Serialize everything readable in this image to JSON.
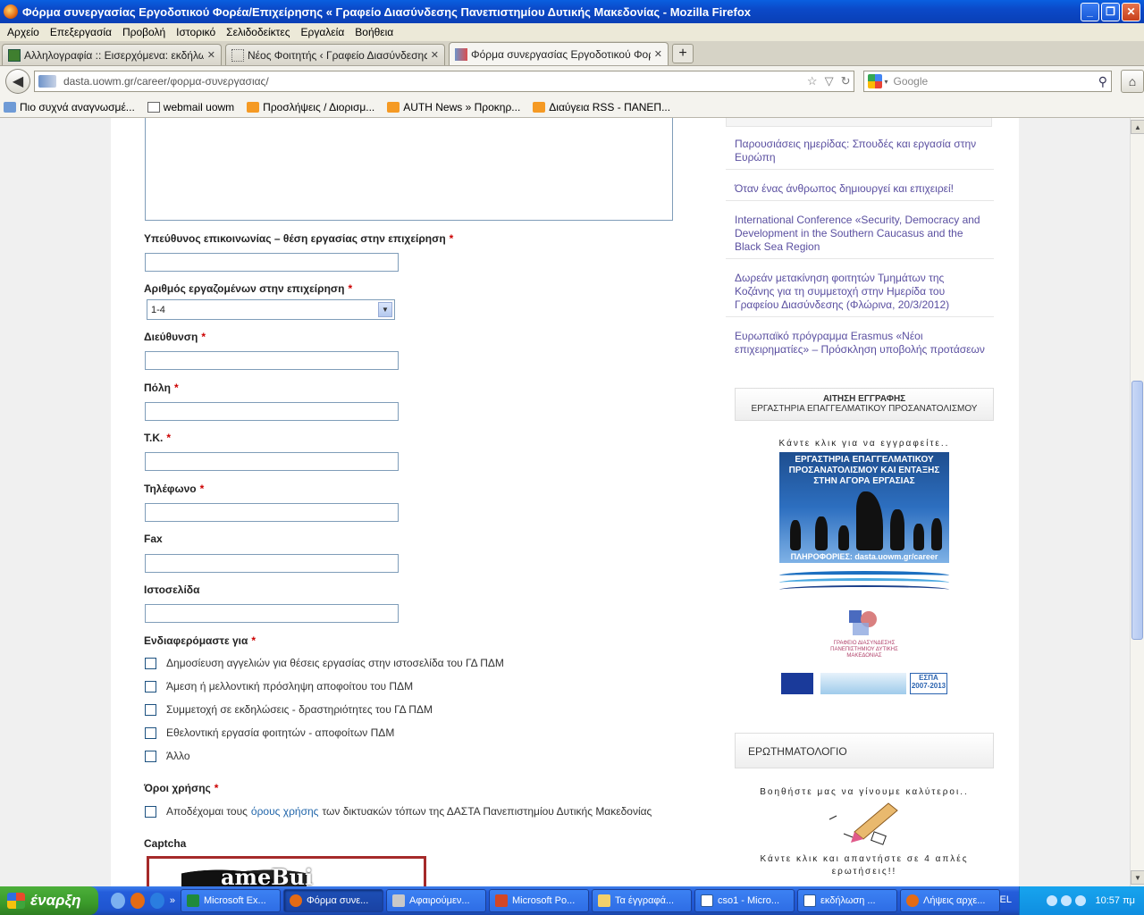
{
  "window": {
    "title": "Φόρμα συνεργασίας Εργοδοτικού Φορέα/Επιχείρησης « Γραφείο Διασύνδεσης Πανεπιστημίου Δυτικής Μακεδονίας - Mozilla Firefox",
    "min": "_",
    "max": "❐",
    "close": "✕"
  },
  "menu": [
    "Αρχείο",
    "Επεξεργασία",
    "Προβολή",
    "Ιστορικό",
    "Σελιδοδείκτες",
    "Εργαλεία",
    "Βοήθεια"
  ],
  "tabs": [
    {
      "label": "Αλληλογραφία :: Εισερχόμενα: εκδήλωσ...",
      "close": "✕"
    },
    {
      "label": "Νέος Φοιτητής ‹ Γραφείο Διασύνδεσης Πα...",
      "close": "✕"
    },
    {
      "label": "Φόρμα συνεργασίας Εργοδοτικού Φορέα/...",
      "close": "✕"
    }
  ],
  "newtab": "+",
  "nav": {
    "back": "◀",
    "url": "dasta.uowm.gr/career/φορμα-συνεργασιας/",
    "star": "☆",
    "dropdown": "▽",
    "reload": "↻",
    "search_placeholder": "Google",
    "search_arrow": "▾",
    "search_icon": "⚲",
    "home": "⌂"
  },
  "bookmarks": [
    {
      "label": "Πιο συχνά αναγνωσμέ...",
      "icon": "bookmark-folder-icon"
    },
    {
      "label": "webmail uowm",
      "icon": "mail-icon"
    },
    {
      "label": "Προσλήψεις / Διορισμ...",
      "icon": "rss-icon"
    },
    {
      "label": "AUTH News » Προκηρ...",
      "icon": "rss-icon"
    },
    {
      "label": "Διαύγεια RSS - ΠΑΝΕΠ...",
      "icon": "rss-icon"
    }
  ],
  "form": {
    "fields": {
      "contact_position": "Υπεύθυνος επικοινωνίας – θέση εργασίας στην επιχείρηση",
      "employees": "Αριθμός εργαζομένων στην επιχείρηση",
      "address": "Διεύθυνση",
      "city": "Πόλη",
      "zip": "Τ.Κ.",
      "phone": "Τηλέφωνο",
      "fax": "Fax",
      "website": "Ιστοσελίδα",
      "interest": "Ενδιαφερόμαστε για",
      "terms": "Όροι χρήσης",
      "captcha": "Captcha"
    },
    "required_mark": "*",
    "employees_value": "1-4",
    "dropdown_arrow": "▼",
    "interest_options": [
      "Δημοσίευση αγγελιών για θέσεις εργασίας στην ιστοσελίδα του ΓΔ ΠΔΜ",
      "Άμεση ή μελλοντική πρόσληψη αποφοίτου του ΠΔΜ",
      "Συμμετοχή σε εκδηλώσεις - δραστηριότητες του ΓΔ ΠΔΜ",
      "Εθελοντική εργασία φοιτητών - αποφοίτων ΠΔΜ",
      "Άλλο"
    ],
    "terms_text_before": "Αποδέχομαι τους",
    "terms_link": "όρους χρήσης",
    "terms_text_after": "των δικτυακών τόπων της ΔΑΣΤΑ Πανεπιστημίου Δυτικής Μακεδονίας",
    "captcha_text": "ameBui"
  },
  "sidebar": {
    "news": [
      "Παρουσιάσεις ημερίδας: Σπουδές και εργασία στην Ευρώπη",
      "Όταν ένας άνθρωπος δημιουργεί και επιχειρεί!",
      "International Conference «Security, Democracy and Development in the Southern Caucasus and the Black Sea Region",
      "Δωρεάν μετακίνηση φοιτητών Τμημάτων της Κοζάνης για τη συμμετοχή στην Ημερίδα του Γραφείου Διασύνδεσης (Φλώρινα, 20/3/2012)",
      "Ευρωπαϊκό πρόγραμμα Erasmus «Νέοι επιχειρηματίες» – Πρόσκληση υποβολής προτάσεων"
    ],
    "registration": {
      "title": "ΑΙΤΗΣΗ ΕΓΓΡΑΦΗΣ",
      "subtitle": "ΕΡΓΑΣΤΗΡΙΑ ΕΠΑΓΓΕΛΜΑΤΙΚΟΥ ΠΡΟΣΑΝΑΤΟΛΙΣΜΟΥ",
      "click_text": "Κάντε κλικ για να εγγραφείτε..",
      "banner_title": "ΕΡΓΑΣΤΗΡΙΑ ΕΠΑΓΓΕΛΜΑΤΙΚΟΥ ΠΡΟΣΑΝΑΤΟΛΙΣΜΟΥ ΚΑΙ ΕΝΤΑΞΗΣ ΣΤΗΝ ΑΓΟΡΑ ΕΡΓΑΣΙΑΣ",
      "banner_info": "ΠΛΗΡΟΦΟΡΙΕΣ: dasta.uowm.gr/career",
      "logo_text": "ΓΡΑΦΕΙΟ ΔΙΑΣΥΝΔΕΣΗΣ ΠΑΝΕΠΙΣΤΗΜΙΟΥ ΔΥΤΙΚΗΣ ΜΑΚΕΔΟΝΙΑΣ",
      "espa": "ΕΣΠΑ 2007-2013"
    },
    "quiz": {
      "title": "ΕΡΩΤΗΜΑΤΟΛΟΓΙΟ",
      "line1": "Βοηθήστε μας να γίνουμε καλύτεροι..",
      "line2": "Κάντε κλικ και απαντήστε σε 4 απλές ερωτήσεις!!"
    }
  },
  "scrollbar": {
    "up": "▲",
    "down": "▼"
  },
  "taskbar": {
    "start": "έναρξη",
    "quick_more": "»",
    "tasks": [
      "Microsoft Ex...",
      "Φόρμα συνε...",
      "Αφαιρούμεν...",
      "Microsoft Po...",
      "Τα έγγραφά...",
      "cso1 - Micro...",
      "εκδήλωση ...",
      "Λήψεις αρχε..."
    ],
    "lang": "EL",
    "clock": "10:57 πμ"
  },
  "colors": {
    "titlebar": "#0b49c8",
    "link": "#5a4fa0",
    "required": "#cc0000",
    "taskbar": "#245edb",
    "start": "#3a9a2a"
  }
}
